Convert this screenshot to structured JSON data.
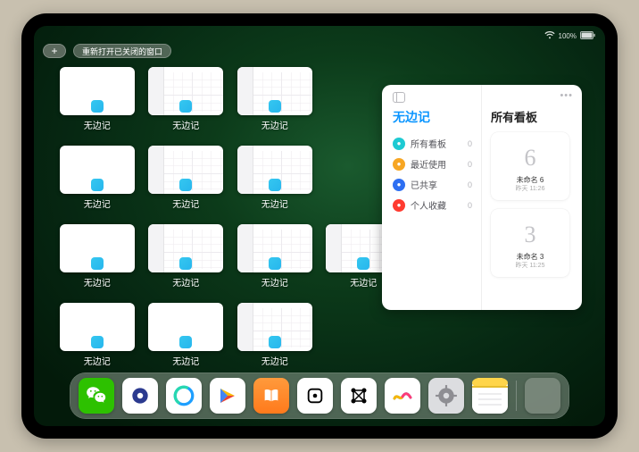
{
  "status": {
    "battery": "100%",
    "wifi_icon": "wifi-icon"
  },
  "topbar": {
    "plus_label": "+",
    "reopen_label": "重新打开已关闭的窗口"
  },
  "stage": {
    "app_label": "无边记",
    "windows": [
      {
        "style": "blank"
      },
      {
        "style": "cal"
      },
      {
        "style": "cal"
      },
      {
        "style": "blank"
      },
      {
        "style": "cal"
      },
      {
        "style": "cal"
      },
      {
        "style": "blank"
      },
      {
        "style": "cal"
      },
      {
        "style": "cal"
      },
      {
        "style": "cal"
      },
      {
        "style": "blank"
      },
      {
        "style": "blank"
      },
      {
        "style": "cal"
      }
    ]
  },
  "panel": {
    "left_title": "无边记",
    "right_title": "所有看板",
    "items": [
      {
        "label": "所有看板",
        "count": 0,
        "color": "#1ecad3"
      },
      {
        "label": "最近使用",
        "count": 0,
        "color": "#f7a623"
      },
      {
        "label": "已共享",
        "count": 0,
        "color": "#2e6ff2"
      },
      {
        "label": "个人收藏",
        "count": 0,
        "color": "#ff3b30"
      }
    ],
    "boards": [
      {
        "drawn": "6",
        "title": "未命名 6",
        "time": "昨天 11:26"
      },
      {
        "drawn": "3",
        "title": "未命名 3",
        "time": "昨天 11:25"
      }
    ]
  },
  "dock": {
    "apps": [
      {
        "name": "wechat",
        "bg": "#2dc100",
        "glyph": "svg-wechat"
      },
      {
        "name": "quark",
        "bg": "#ffffff",
        "glyph": "svg-quark"
      },
      {
        "name": "qqbrowser",
        "bg": "#ffffff",
        "glyph": "svg-qq"
      },
      {
        "name": "play",
        "bg": "#ffffff",
        "glyph": "svg-play"
      },
      {
        "name": "books",
        "bg": "linear-gradient(180deg,#ff9a3c,#ff7a1c)",
        "glyph": "svg-books"
      },
      {
        "name": "dice",
        "bg": "#ffffff",
        "glyph": "svg-dice"
      },
      {
        "name": "nodes",
        "bg": "#ffffff",
        "glyph": "svg-nodes"
      },
      {
        "name": "freeform",
        "bg": "#ffffff",
        "glyph": "svg-freeform"
      },
      {
        "name": "settings",
        "bg": "#dcdde0",
        "glyph": "svg-gear"
      },
      {
        "name": "notes",
        "bg": "#ffffff",
        "glyph": "svg-notes"
      }
    ]
  }
}
